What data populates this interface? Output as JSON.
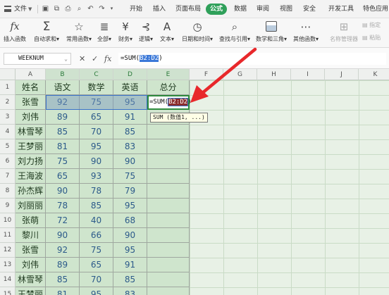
{
  "menu": {
    "file": "文件",
    "tabs": [
      "开始",
      "插入",
      "页面布局",
      "公式",
      "数据",
      "审阅",
      "视图",
      "安全",
      "开发工具",
      "特色应用"
    ],
    "active_tab": "公式"
  },
  "ribbon": {
    "insert_fn": "插入函数",
    "autosum": "自动求和",
    "common": "常用函数",
    "all": "全部",
    "finance": "财务",
    "logic": "逻辑",
    "text": "文本",
    "datetime": "日期和时间",
    "lookup": "查找与引用",
    "math": "数学和三角",
    "other": "其他函数",
    "name_mgr": "名称管理器",
    "paste": "粘贴",
    "specify": "指定"
  },
  "formula_bar": {
    "name_box": "WEEKNUM",
    "fx_label": "fx",
    "formula_prefix": "=SUM(",
    "formula_ref": "B2:D2",
    "formula_suffix": ")"
  },
  "sheet": {
    "columns": [
      "A",
      "B",
      "C",
      "D",
      "E",
      "F",
      "G",
      "H",
      "I",
      "J",
      "K"
    ],
    "rows": [
      "1",
      "2",
      "3",
      "4",
      "5",
      "6",
      "7",
      "8",
      "9",
      "10",
      "11",
      "12",
      "13",
      "14",
      "15"
    ],
    "header": [
      "姓名",
      "语文",
      "数学",
      "英语",
      "总分"
    ],
    "data": [
      [
        "张雪",
        "92",
        "75",
        "95"
      ],
      [
        "刘伟",
        "89",
        "65",
        "91"
      ],
      [
        "林雪琴",
        "85",
        "70",
        "85"
      ],
      [
        "王梦丽",
        "81",
        "95",
        "83"
      ],
      [
        "刘力扬",
        "75",
        "90",
        "90"
      ],
      [
        "王海波",
        "65",
        "93",
        "75"
      ],
      [
        "孙杰辉",
        "90",
        "78",
        "79"
      ],
      [
        "刘丽丽",
        "78",
        "85",
        "95"
      ],
      [
        "张萌",
        "72",
        "40",
        "68"
      ],
      [
        "黎川",
        "90",
        "66",
        "90"
      ],
      [
        "张雪",
        "92",
        "75",
        "95"
      ],
      [
        "刘伟",
        "89",
        "65",
        "91"
      ],
      [
        "林雪琴",
        "85",
        "70",
        "85"
      ],
      [
        "王梦丽",
        "81",
        "95",
        "83"
      ]
    ],
    "edit_prefix": "=SUM(",
    "edit_ref": "B2:D2",
    "edit_suffix": ")",
    "tooltip": "SUM (数值1, ...)"
  },
  "colors": {
    "accent": "#2fa05a",
    "arrow": "#e8282b",
    "selection": "#3b73c8"
  }
}
